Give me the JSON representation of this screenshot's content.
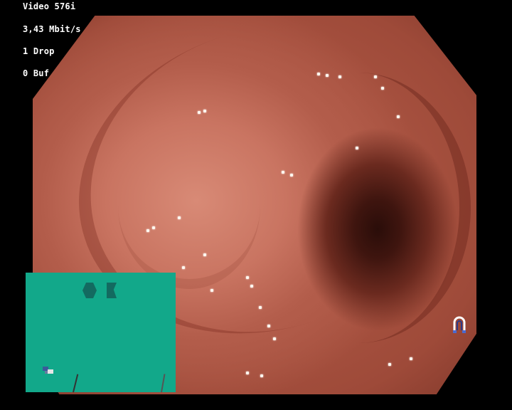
{
  "osd": {
    "video_label": "Video 576i",
    "bitrate": "3,43 Mbit/s",
    "drop": "1 Drop",
    "buffer": "0 Buf"
  },
  "pip": {
    "background_color": "#12a88a",
    "shape_color": "#136a60"
  },
  "icons": {
    "scope_tip": "magnet-icon"
  }
}
